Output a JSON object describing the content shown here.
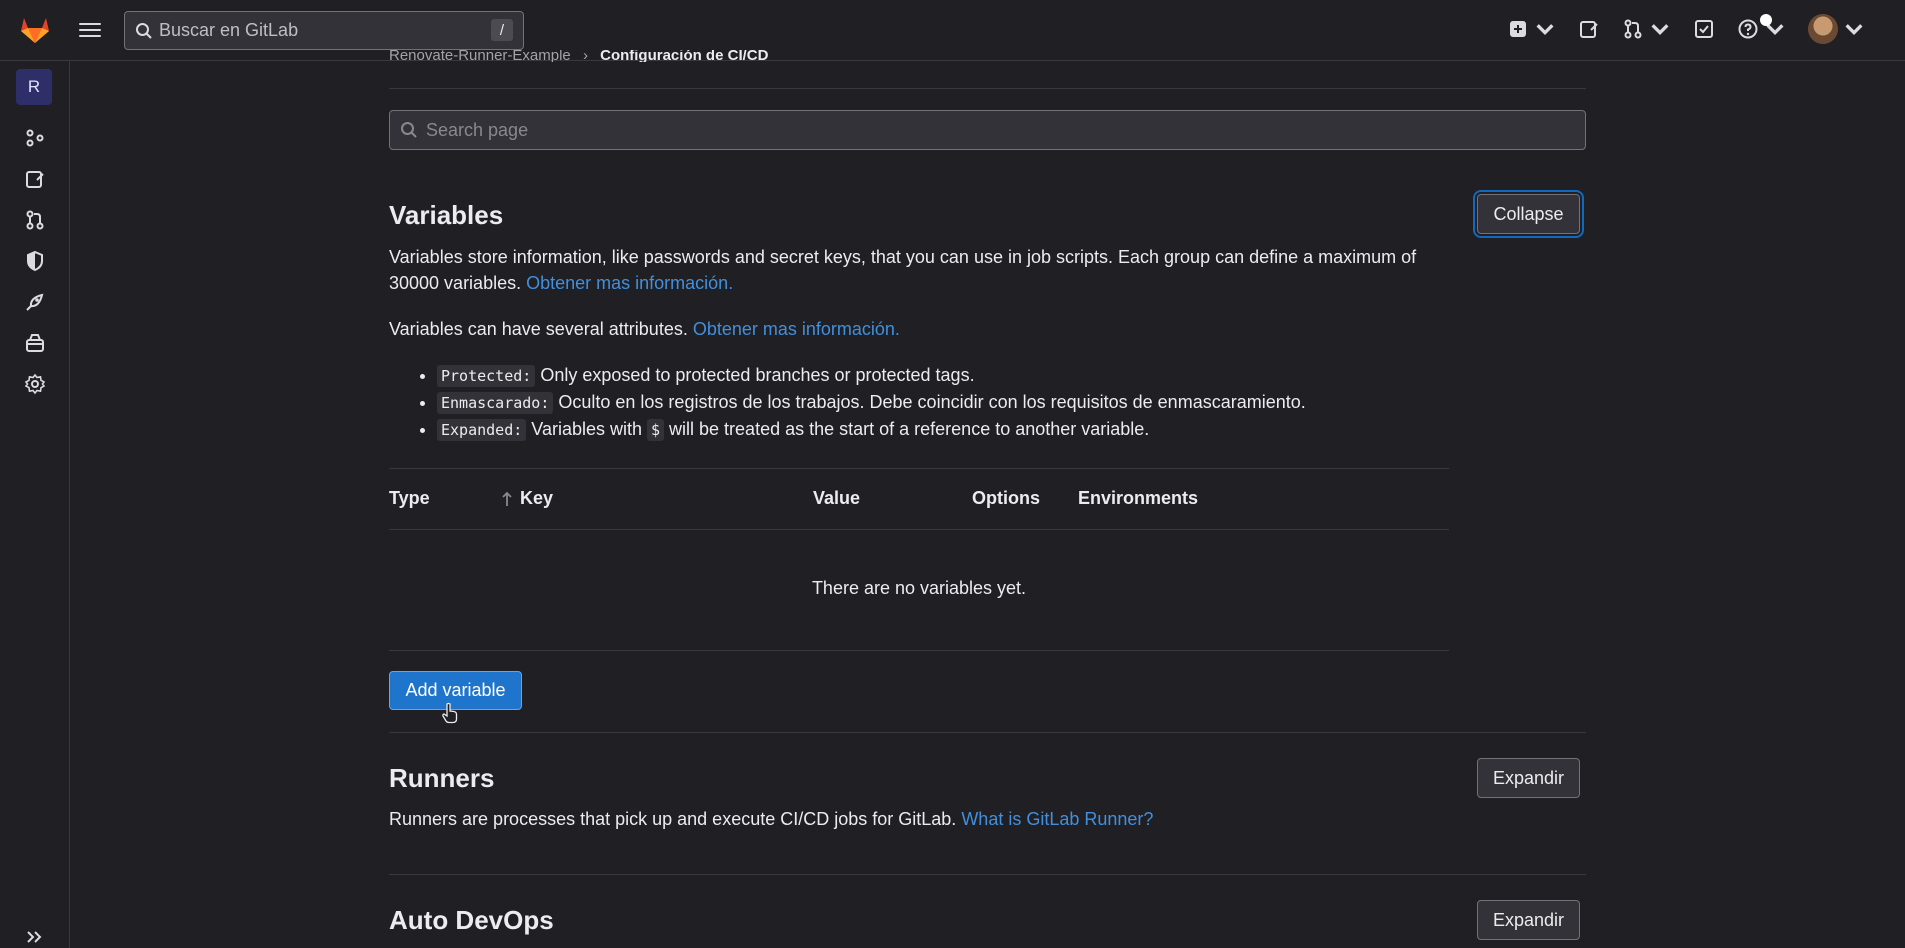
{
  "topbar": {
    "search_placeholder": "Buscar en GitLab",
    "search_shortcut": "/"
  },
  "sidebar": {
    "project_initial": "R"
  },
  "breadcrumb": {
    "parent": "Renovate-Runner-Example",
    "separator": "›",
    "current": "Configuración de CI/CD"
  },
  "page_search": {
    "placeholder": "Search page"
  },
  "variables": {
    "title": "Variables",
    "collapse_label": "Collapse",
    "description": "Variables store information, like passwords and secret keys, that you can use in job scripts. Each group can define a maximum of 30000 variables.",
    "learn_more": "Obtener mas información.",
    "attributes_intro": "Variables can have several attributes.",
    "attributes_learn_more": "Obtener mas información.",
    "attributes": [
      {
        "code": "Protected:",
        "text": " Only exposed to protected branches or protected tags."
      },
      {
        "code": "Enmascarado:",
        "text": " Oculto en los registros de los trabajos. Debe coincidir con los requisitos de enmascaramiento."
      },
      {
        "code": "Expanded:",
        "text_before": " Variables with ",
        "inline_code": "$",
        "text_after": " will be treated as the start of a reference to another variable."
      }
    ],
    "table": {
      "columns": [
        "Type",
        "Key",
        "Value",
        "Options",
        "Environments"
      ],
      "empty_text": "There are no variables yet."
    },
    "add_button": "Add variable"
  },
  "runners": {
    "title": "Runners",
    "expand_label": "Expandir",
    "description": "Runners are processes that pick up and execute CI/CD jobs for GitLab.",
    "link": "What is GitLab Runner?"
  },
  "auto_devops": {
    "title": "Auto DevOps",
    "expand_label": "Expandir"
  },
  "colors": {
    "background": "#1f1f24",
    "link": "#428fdc",
    "primary_button": "#1f75cb",
    "logo_orange": "#e24329"
  }
}
